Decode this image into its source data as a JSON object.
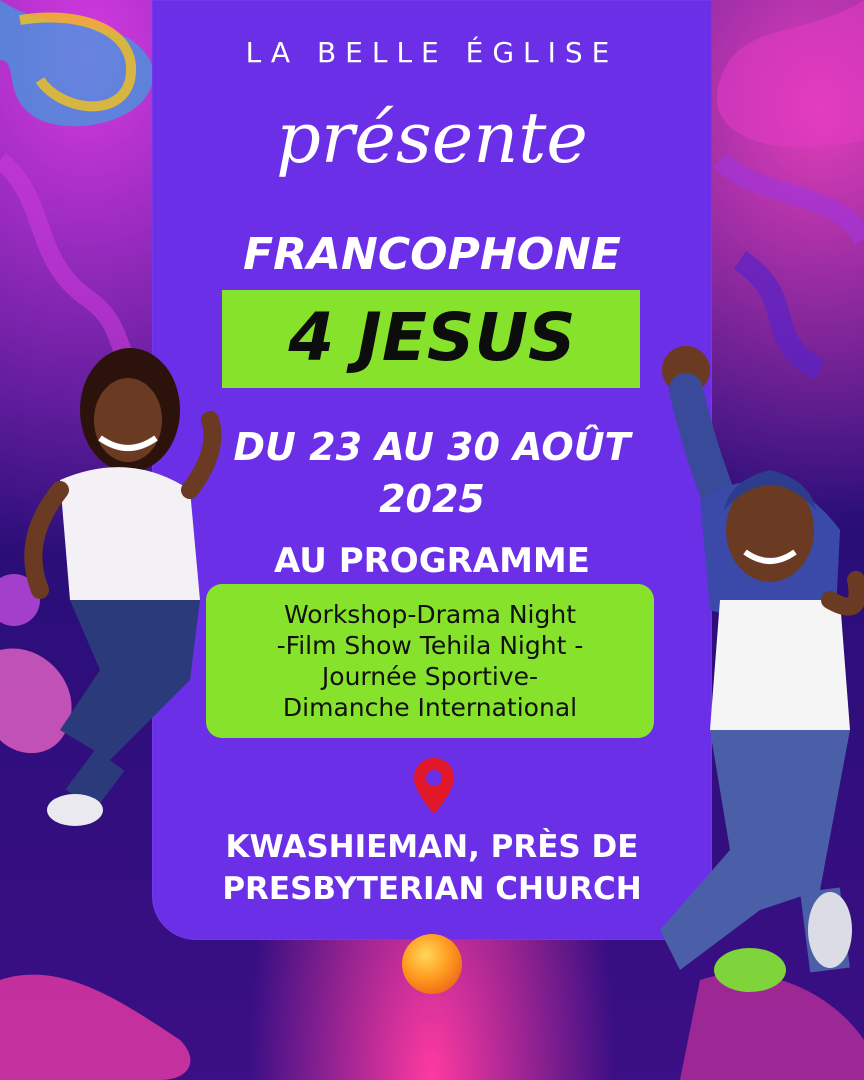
{
  "poster": {
    "organizer": "LA BELLE ÉGLISE",
    "presents": "présente",
    "title_line1": "FRANCOPHONE",
    "title_line2": "4 JESUS",
    "date_line1": "DU 23 AU 30 AOÛT",
    "date_line2": "2025",
    "program_label": "AU PROGRAMME",
    "program_text": "Workshop-Drama Night\n-Film Show Tehila Night -\nJournée Sportive-\nDimanche International",
    "location_icon": "map-pin-icon",
    "location": "KWASHIEMAN, PRÈS DE\nPRESBYTERIAN CHURCH"
  },
  "colors": {
    "panel": "#6b2fe8",
    "accent_green": "#86e22a",
    "pin_red": "#e0182a",
    "text": "#ffffff"
  }
}
